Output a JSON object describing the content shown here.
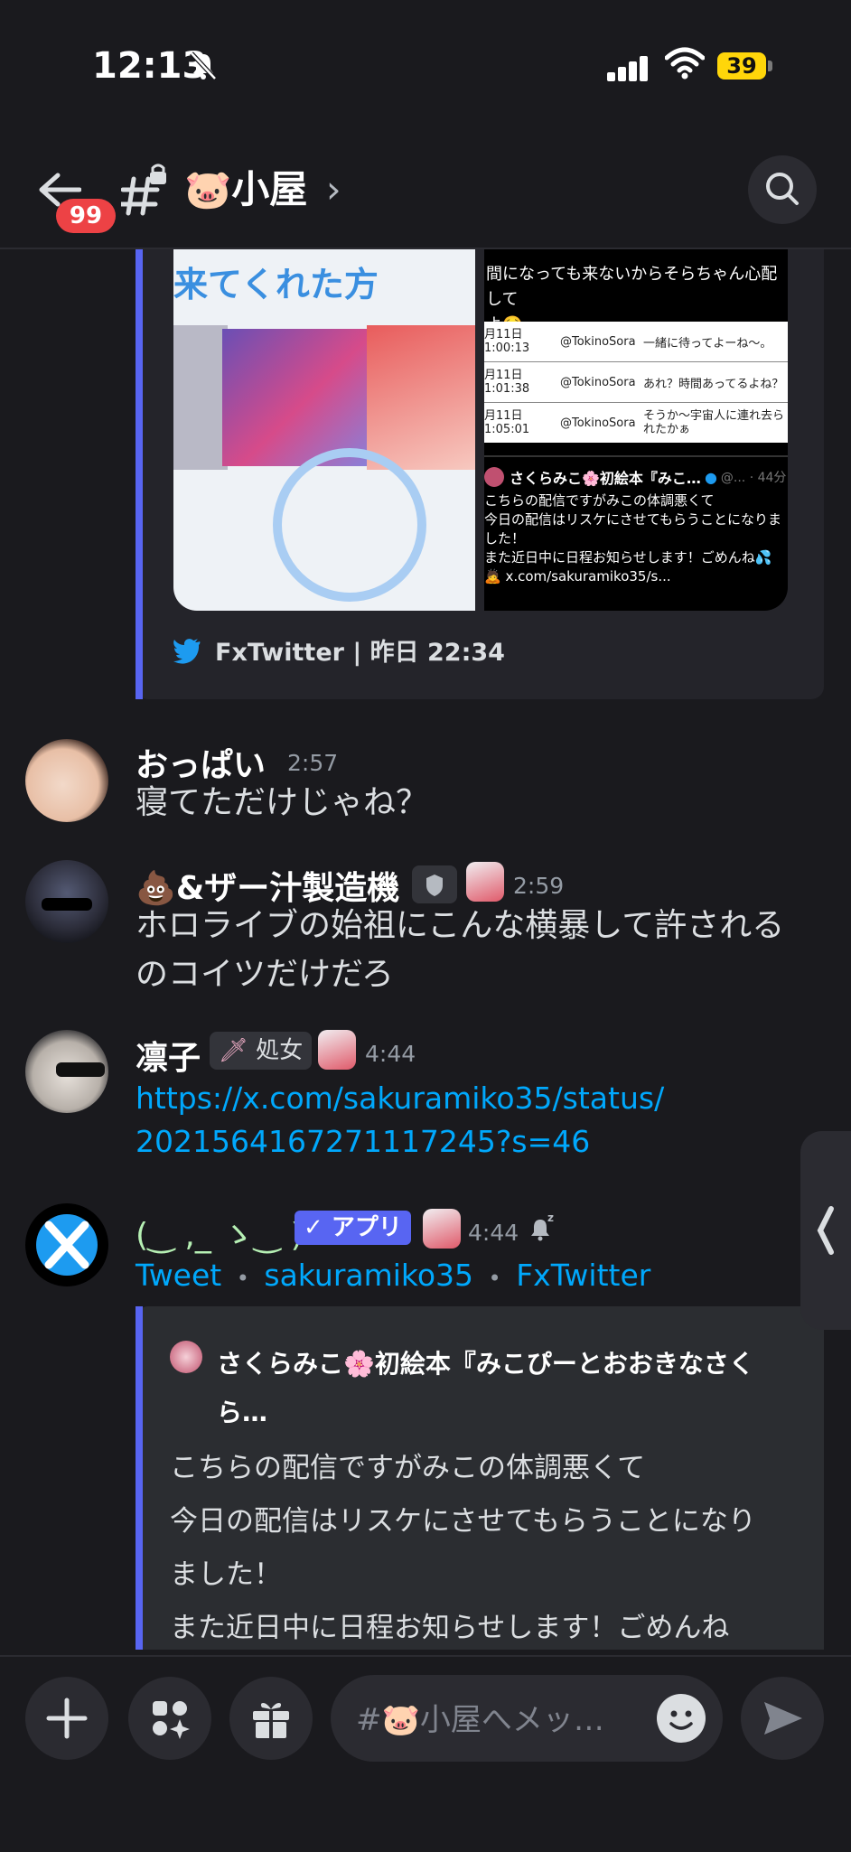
{
  "status_bar": {
    "time": "12:13",
    "battery": "39"
  },
  "header": {
    "unread_badge": "99",
    "channel_name": "🐷小屋",
    "channel_chevron": "›"
  },
  "embed_top": {
    "image_left_caption": "来てくれた方",
    "image_right": {
      "top_text": "間になっても来ないからそらちゃん心配して\nよ🥺",
      "rows": [
        {
          "date": "月11日\n1:00:13",
          "user": "@TokinoSora",
          "msg": "一緒に待ってよーね〜。"
        },
        {
          "date": "月11日\n1:01:38",
          "user": "@TokinoSora",
          "msg": "あれ？時間あってるよね？"
        },
        {
          "date": "月11日\n1:05:01",
          "user": "@TokinoSora",
          "msg": "そうか〜宇宙人に連れ去ら\nれたかぁ"
        }
      ],
      "tweet_author": "さくらみこ🌸初絵本『みこ…",
      "tweet_meta": "@... · 44分",
      "tweet_text": "こちらの配信ですがみこの体調悪くて\n今日の配信はリスケにさせてもらうことになりま\nした！\nまた近日中に日程お知らせします！ごめんね💦\n🙇 x.com/sakuramiko35/s..."
    },
    "footer": "FxTwitter | 昨日 22:34"
  },
  "messages": [
    {
      "username": "おっぱい",
      "time": "2:57",
      "text": "寝てただけじゃね？"
    },
    {
      "username": "💩&ザー汁製造機",
      "time": "2:59",
      "text_line1": "ホロライブの始祖にこんな横暴して許される",
      "text_line2": "のコイツだけだろ"
    },
    {
      "username": "凛子",
      "role": "処女",
      "time": "4:44",
      "link_line1": "https://x.com/sakuramiko35/status/",
      "link_line2": "2021564167271117245?s=46"
    },
    {
      "username": "(‿ ,_ ゝ‿ )",
      "app_tag": "✓ アプリ",
      "time": "4:44",
      "links": [
        "Tweet",
        "sakuramiko35",
        "FxTwitter"
      ],
      "separator": "•"
    }
  ],
  "embed_bottom": {
    "author_line1": "さくらみこ🌸初絵本『みこぴーとおおきなさく",
    "author_line2": "ら…",
    "lines": [
      "こちらの配信ですがみこの体調悪くて",
      "今日の配信はリスケにさせてもらうことになり",
      "ました！",
      "また近日中に日程お知らせします！ごめんね"
    ]
  },
  "composer": {
    "placeholder": "#🐷小屋へメッ…"
  },
  "colors": {
    "accent": "#5865f2",
    "link": "#00a8fc",
    "badge": "#ed4245",
    "background": "#1a1a1e"
  },
  "icons": [
    "bell-off-icon",
    "back-arrow-icon",
    "channel-lock-icon",
    "search-icon",
    "twitter-bird-icon",
    "plus-icon",
    "apps-icon",
    "gift-icon",
    "emoji-icon",
    "send-icon",
    "snooze-icon",
    "sword-icon",
    "chevron-left-icon"
  ]
}
